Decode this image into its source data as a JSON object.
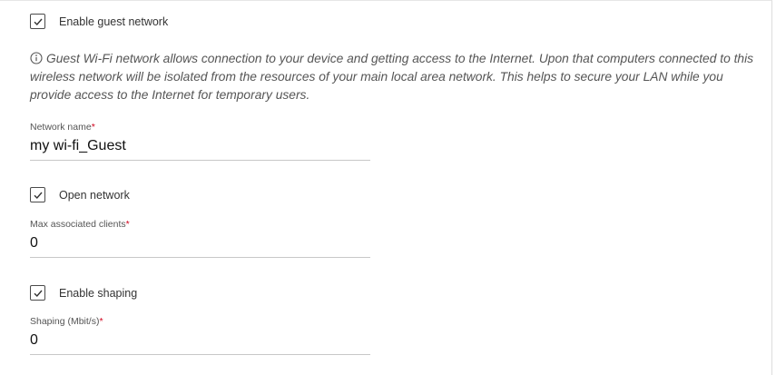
{
  "guest_network": {
    "enable_label": "Enable guest network",
    "enable_checked": true,
    "info_text": "Guest Wi-Fi network allows connection to your device and getting access to the Internet. Upon that computers connected to this wireless network will be isolated from the resources of your main local area network. This helps to secure your LAN while you provide access to the Internet for temporary users."
  },
  "network_name": {
    "label": "Network name",
    "required_mark": "*",
    "value": "my wi-fi_Guest"
  },
  "open_network": {
    "label": "Open network",
    "checked": true
  },
  "max_clients": {
    "label": "Max associated clients",
    "required_mark": "*",
    "value": "0"
  },
  "shaping": {
    "enable_label": "Enable shaping",
    "enable_checked": true,
    "label": "Shaping (Mbit/s)",
    "required_mark": "*",
    "value": "0"
  },
  "icons": {
    "checkbox": "check-icon",
    "info": "info-icon"
  },
  "colors": {
    "required": "#d0021b",
    "checkbox_border": "#4a4a4a",
    "text": "#222222"
  }
}
